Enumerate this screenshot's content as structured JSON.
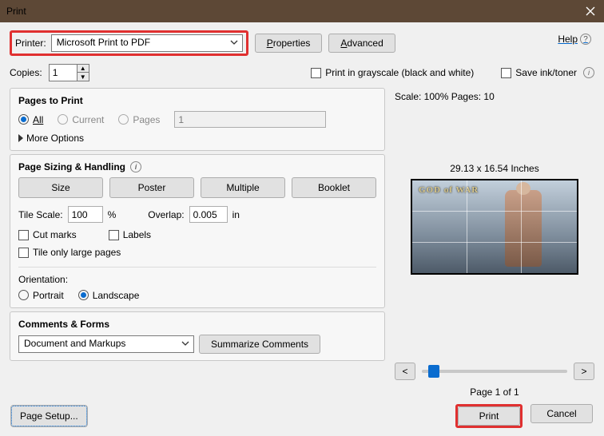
{
  "title": "Print",
  "help_label": "Help",
  "printer": {
    "label": "Printer:",
    "selected": "Microsoft Print to PDF",
    "properties_btn": "Properties",
    "advanced_btn": "Advanced"
  },
  "copies": {
    "label": "Copies:",
    "value": "1"
  },
  "grayscale": "Print in grayscale (black and white)",
  "save_ink": "Save ink/toner",
  "pages_to_print": {
    "title": "Pages to Print",
    "all": "All",
    "current": "Current",
    "pages": "Pages",
    "range_value": "1",
    "more": "More Options"
  },
  "sizing": {
    "title": "Page Sizing & Handling",
    "size": "Size",
    "poster": "Poster",
    "multiple": "Multiple",
    "booklet": "Booklet",
    "tile_scale_label": "Tile Scale:",
    "tile_scale_value": "100",
    "percent": "%",
    "overlap_label": "Overlap:",
    "overlap_value": "0.005",
    "overlap_unit": "in",
    "cut_marks": "Cut marks",
    "labels": "Labels",
    "tile_large": "Tile only large pages"
  },
  "orientation": {
    "title": "Orientation:",
    "portrait": "Portrait",
    "landscape": "Landscape"
  },
  "comments": {
    "title": "Comments & Forms",
    "selected": "Document and Markups",
    "summarize": "Summarize Comments"
  },
  "preview": {
    "scale_pages": "Scale: 100% Pages: 10",
    "dims": "29.13 x 16.54 Inches",
    "gow_text": "GOD of WAR",
    "page_of": "Page 1 of 1",
    "prev": "<",
    "next": ">"
  },
  "footer": {
    "page_setup": "Page Setup...",
    "print": "Print",
    "cancel": "Cancel"
  }
}
